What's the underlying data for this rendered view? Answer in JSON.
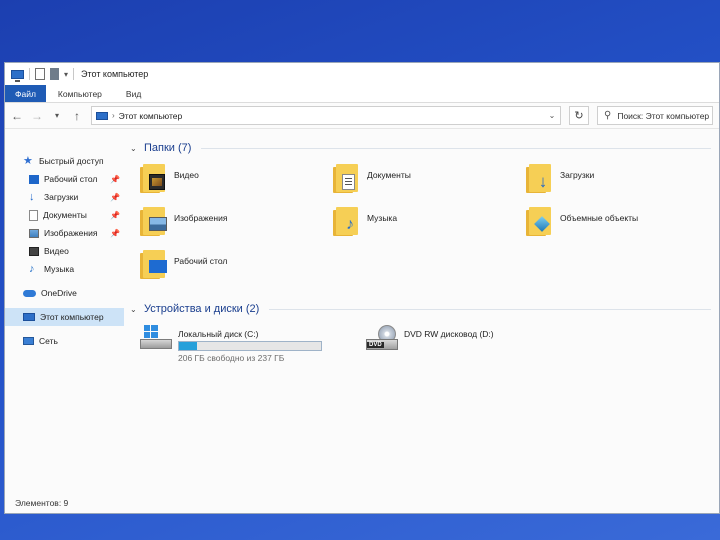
{
  "window": {
    "title": "Этот компьютер"
  },
  "ribbon": {
    "tabs": [
      "Файл",
      "Компьютер",
      "Вид"
    ]
  },
  "address": {
    "path": "Этот компьютер"
  },
  "search": {
    "placeholder": "Поиск: Этот компьютер"
  },
  "nav": {
    "quick_access": "Быстрый доступ",
    "items": [
      {
        "label": "Рабочий стол",
        "pinned": true,
        "icon": "desktop-icon"
      },
      {
        "label": "Загрузки",
        "pinned": true,
        "icon": "download-icon"
      },
      {
        "label": "Документы",
        "pinned": true,
        "icon": "document-icon"
      },
      {
        "label": "Изображения",
        "pinned": true,
        "icon": "picture-icon"
      },
      {
        "label": "Видео",
        "pinned": false,
        "icon": "video-icon"
      },
      {
        "label": "Музыка",
        "pinned": false,
        "icon": "music-icon"
      }
    ],
    "onedrive": "OneDrive",
    "this_pc": "Этот компьютер",
    "network": "Сеть"
  },
  "folders_section": {
    "title": "Папки (7)"
  },
  "folders": [
    {
      "label": "Видео",
      "icon": "video-folder-icon"
    },
    {
      "label": "Документы",
      "icon": "documents-folder-icon"
    },
    {
      "label": "Загрузки",
      "icon": "downloads-folder-icon"
    },
    {
      "label": "Изображения",
      "icon": "pictures-folder-icon"
    },
    {
      "label": "Музыка",
      "icon": "music-folder-icon"
    },
    {
      "label": "Объемные объекты",
      "icon": "3d-objects-folder-icon"
    },
    {
      "label": "Рабочий стол",
      "icon": "desktop-folder-icon"
    }
  ],
  "drives_section": {
    "title": "Устройства и диски (2)"
  },
  "drives": [
    {
      "label": "Локальный диск (C:)",
      "free_text": "206 ГБ свободно из 237 ГБ",
      "used_fraction": 0.13,
      "icon": "hdd-icon"
    },
    {
      "label": "DVD RW дисковод (D:)",
      "badge": "DVD",
      "icon": "dvd-drive-icon"
    }
  ],
  "status": {
    "items_count": "Элементов: 9"
  },
  "colors": {
    "accent": "#1f5bb5",
    "selection": "#cde3f7",
    "section_title": "#1a3e8e",
    "drive_bar": "#26a0da"
  }
}
